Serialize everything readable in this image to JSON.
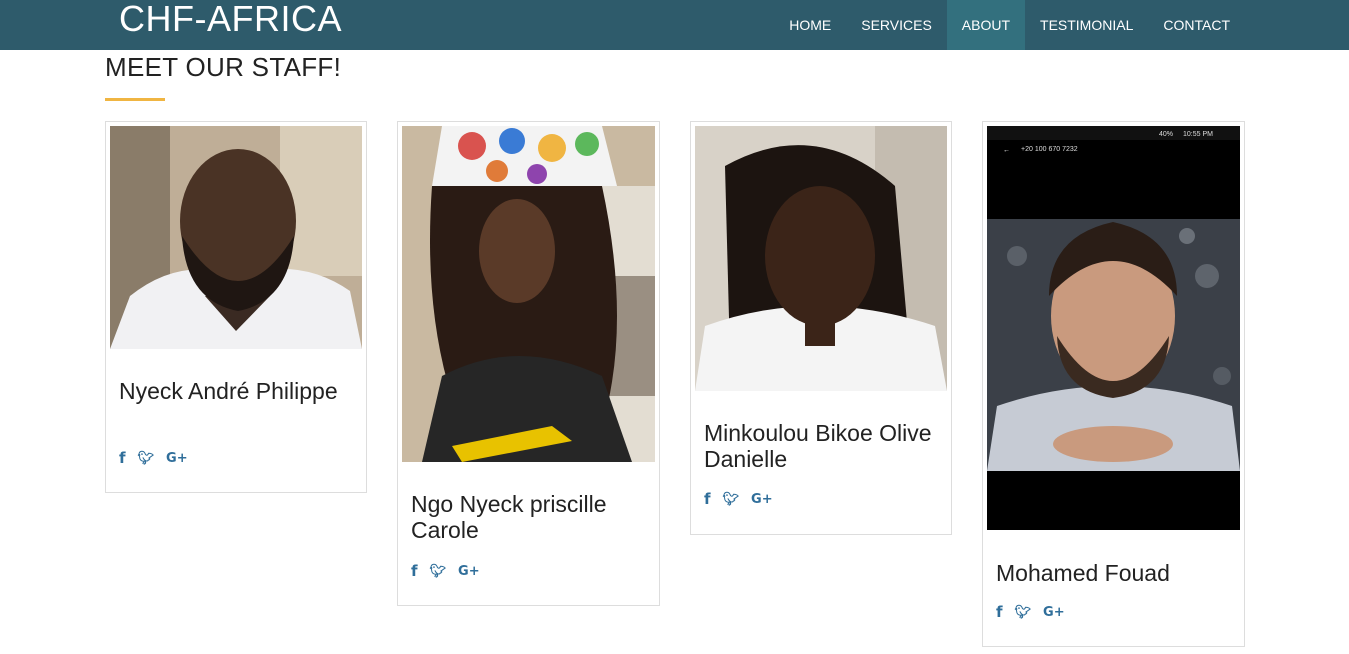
{
  "brand": "CHF-AFRICA",
  "nav": {
    "items": [
      "HOME",
      "SERVICES",
      "ABOUT",
      "TESTIMONIAL",
      "CONTACT"
    ],
    "active": "ABOUT"
  },
  "section": {
    "title": "MEET OUR STAFF!"
  },
  "staff": [
    {
      "name": "Nyeck André Philippe",
      "photo": "portrait-photo"
    },
    {
      "name": "Ngo Nyeck priscille Carole",
      "photo": "portrait-photo"
    },
    {
      "name": "Minkoulou Bikoe Olive Danielle",
      "photo": "portrait-photo"
    },
    {
      "name": "Mohamed Fouad",
      "photo": "phone-screenshot-portrait"
    }
  ],
  "social_icons": {
    "facebook": "f",
    "twitter": "t",
    "google_plus": "G+"
  },
  "phone_status": {
    "number": "+20 100 670 7232",
    "time": "10:55 PM",
    "battery": "40%"
  },
  "colors": {
    "navbar": "#2e5b6b",
    "nav_active": "#33707e",
    "accent_underline": "#f0b542",
    "social_icon": "#2f6e9a"
  }
}
